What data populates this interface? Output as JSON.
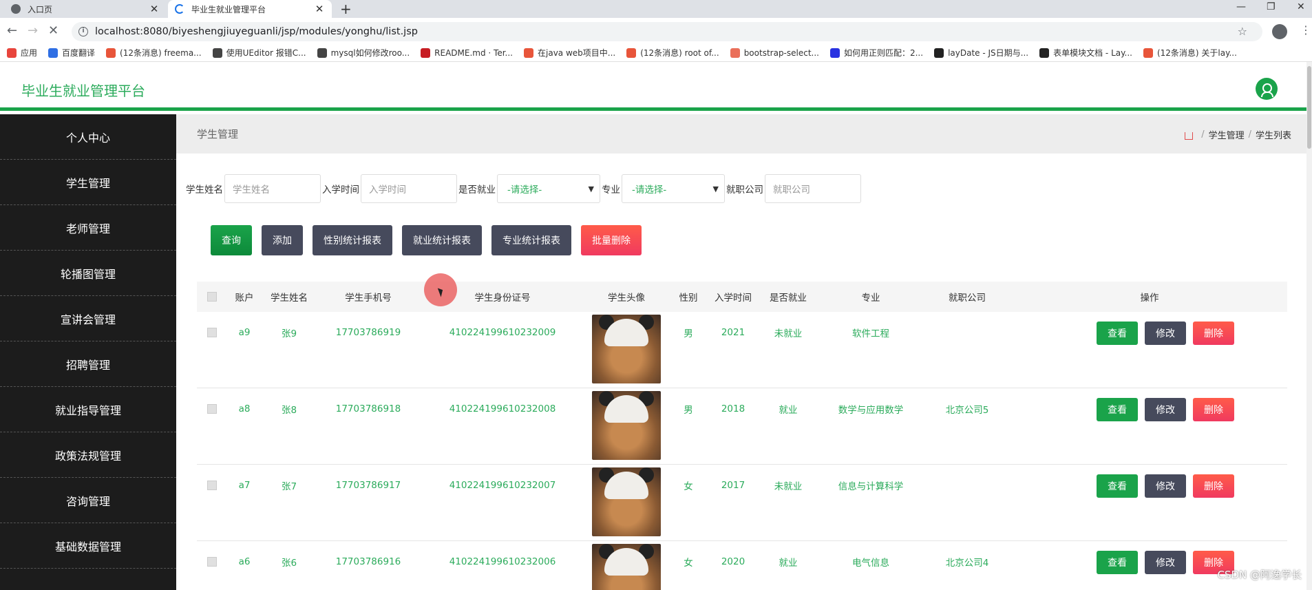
{
  "browser": {
    "tabs": [
      {
        "title": "入口页",
        "state": "inactive"
      },
      {
        "title": "毕业生就业管理平台",
        "state": "active-loading"
      }
    ],
    "new_tab": "+",
    "url": "localhost:8080/biyeshengjiuyeguanli/jsp/modules/yonghu/list.jsp",
    "bookmarks": [
      {
        "label": "应用",
        "icon": "apps-icon",
        "color": "#e8453c"
      },
      {
        "label": "百度翻译",
        "icon": "baidu-translate-icon",
        "color": "#2f6fe4"
      },
      {
        "label": "(12条消息) freema...",
        "icon": "csdn-icon",
        "color": "#e8553a"
      },
      {
        "label": "使用UEditor 报错C...",
        "icon": "feather-icon",
        "color": "#444444"
      },
      {
        "label": "mysql如何修改roo...",
        "icon": "feather-icon",
        "color": "#444444"
      },
      {
        "label": "README.md · Ter...",
        "icon": "gitee-icon",
        "color": "#c71d23"
      },
      {
        "label": "在java web项目中...",
        "icon": "csdn-icon",
        "color": "#e8553a"
      },
      {
        "label": "(12条消息) root of...",
        "icon": "csdn-icon",
        "color": "#e8553a"
      },
      {
        "label": "bootstrap-select...",
        "icon": "jianshu-icon",
        "color": "#ea6f5a"
      },
      {
        "label": "如何用正则匹配：2...",
        "icon": "baidu-paw-icon",
        "color": "#2932e1"
      },
      {
        "label": "layDate - JS日期与...",
        "icon": "layui-icon",
        "color": "#222222"
      },
      {
        "label": "表单模块文档 - Lay...",
        "icon": "layui-icon",
        "color": "#222222"
      },
      {
        "label": "(12条消息) 关于lay...",
        "icon": "csdn-icon",
        "color": "#e8553a"
      }
    ]
  },
  "header": {
    "title": "毕业生就业管理平台",
    "accent_color": "#1aa34a"
  },
  "sidebar": {
    "items": [
      {
        "label": "个人中心"
      },
      {
        "label": "学生管理"
      },
      {
        "label": "老师管理"
      },
      {
        "label": "轮播图管理"
      },
      {
        "label": "宣讲会管理"
      },
      {
        "label": "招聘管理"
      },
      {
        "label": "就业指导管理"
      },
      {
        "label": "政策法规管理"
      },
      {
        "label": "咨询管理"
      },
      {
        "label": "基础数据管理"
      }
    ]
  },
  "page": {
    "title": "学生管理",
    "breadcrumb": [
      "学生管理",
      "学生列表"
    ]
  },
  "search": {
    "name_label": "学生姓名",
    "name_placeholder": "学生姓名",
    "date_label": "入学时间",
    "date_placeholder": "入学时间",
    "employed_label": "是否就业",
    "employed_value": "-请选择-",
    "major_label": "专业",
    "major_value": "-请选择-",
    "company_label": "就职公司",
    "company_placeholder": "就职公司"
  },
  "toolbar": {
    "query": "查询",
    "add": "添加",
    "gender_report": "性别统计报表",
    "employment_report": "就业统计报表",
    "major_report": "专业统计报表",
    "batch_delete": "批量删除"
  },
  "table": {
    "headers": [
      "账户",
      "学生姓名",
      "学生手机号",
      "学生身份证号",
      "学生头像",
      "性别",
      "入学时间",
      "是否就业",
      "专业",
      "就职公司",
      "操作"
    ],
    "actions": {
      "view": "查看",
      "edit": "修改",
      "delete": "删除"
    },
    "rows": [
      {
        "account": "a9",
        "name": "张9",
        "phone": "17703786919",
        "id_card": "410224199610232009",
        "gender": "男",
        "year": "2021",
        "employed": "未就业",
        "major": "软件工程",
        "company": ""
      },
      {
        "account": "a8",
        "name": "张8",
        "phone": "17703786918",
        "id_card": "410224199610232008",
        "gender": "男",
        "year": "2018",
        "employed": "就业",
        "major": "数学与应用数学",
        "company": "北京公司5"
      },
      {
        "account": "a7",
        "name": "张7",
        "phone": "17703786917",
        "id_card": "410224199610232007",
        "gender": "女",
        "year": "2017",
        "employed": "未就业",
        "major": "信息与计算科学",
        "company": ""
      },
      {
        "account": "a6",
        "name": "张6",
        "phone": "17703786916",
        "id_card": "410224199610232006",
        "gender": "女",
        "year": "2020",
        "employed": "就业",
        "major": "电气信息",
        "company": "北京公司4"
      }
    ]
  },
  "watermark": "CSDN @阿逸学长"
}
